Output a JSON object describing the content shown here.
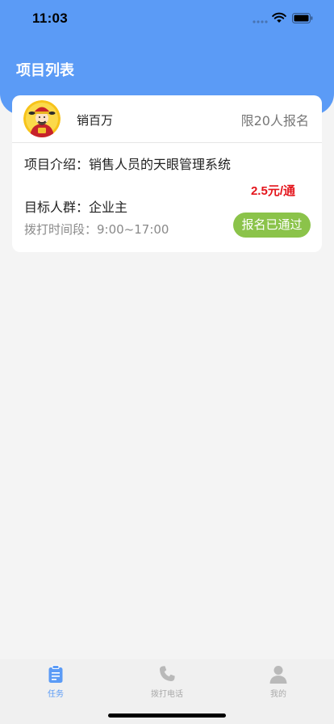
{
  "status_bar": {
    "time": "11:03"
  },
  "header": {
    "title": "项目列表"
  },
  "project_card": {
    "company_name": "销百万",
    "quota": "限20人报名",
    "intro": "项目介绍：销售人员的天眼管理系统",
    "price": "2.5元/通",
    "target": "目标人群：企业主",
    "call_time": "拨打时间段：9:00~17:00",
    "status": "报名已通过"
  },
  "tabbar": {
    "tabs": [
      {
        "label": "任务",
        "icon": "clipboard-icon",
        "active": true
      },
      {
        "label": "拨打电话",
        "icon": "phone-icon",
        "active": false
      },
      {
        "label": "我的",
        "icon": "person-icon",
        "active": false
      }
    ]
  },
  "colors": {
    "accent": "#5b9bf6",
    "price": "#e4141b",
    "approved": "#8bc34a"
  }
}
